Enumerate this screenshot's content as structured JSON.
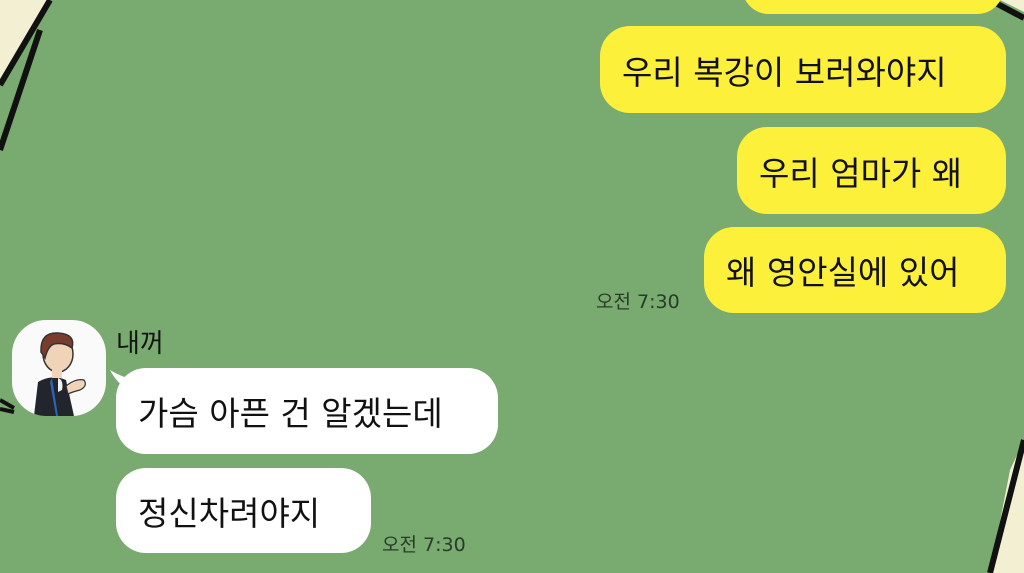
{
  "chat": {
    "outgoing": [
      {
        "text": "우리 복강이 보러와야지"
      },
      {
        "text": "우리 엄마가 왜"
      },
      {
        "text": "왜 영안실에 있어"
      }
    ],
    "outgoing_time": "오전 7:30",
    "incoming_sender": "내꺼",
    "incoming": [
      {
        "text": "가슴 아픈 건 알겠는데"
      },
      {
        "text": "정신차려야지"
      }
    ],
    "incoming_time": "오전 7:30"
  },
  "colors": {
    "background": "#79aa6f",
    "outgoing_bubble": "#fdf03b",
    "incoming_bubble": "#ffffff"
  }
}
